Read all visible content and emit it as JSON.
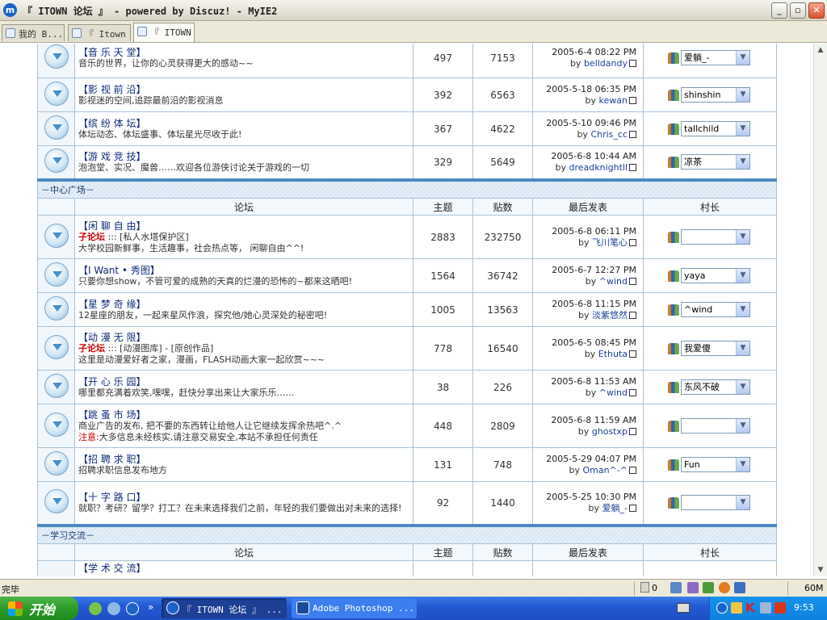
{
  "window": {
    "title": "『 ITOWN 论坛 』 - powered by Discuz! - MyIE2",
    "min": "_",
    "max": "▫",
    "close": "✕"
  },
  "tabs": [
    {
      "label": "我的 B..."
    },
    {
      "label": "『 Itown ..."
    },
    {
      "label": "『 ITOWN ..."
    }
  ],
  "forum": {
    "section1_rows": [
      {
        "name": "【音 乐 天 堂】",
        "desc": "音乐的世界，让你的心灵获得更大的感动~~",
        "topics": "497",
        "posts": "7153",
        "date": "2005-6-4 08:22 PM",
        "by": "by",
        "user": "belldandy",
        "moderator": "爱躺_-"
      },
      {
        "name": "【影 视 前 沿】",
        "desc": "影视迷的空间,追踪最前沿的影视消息",
        "topics": "392",
        "posts": "6563",
        "date": "2005-5-18 06:35 PM",
        "by": "by",
        "user": "kewan",
        "moderator": "shinshin"
      },
      {
        "name": "【缤 纷 体 坛】",
        "desc": "体坛动态、体坛盛事、体坛星光尽收于此!",
        "topics": "367",
        "posts": "4622",
        "date": "2005-5-10 09:46 PM",
        "by": "by",
        "user": "Chris_cc",
        "moderator": "tallchild"
      },
      {
        "name": "【游 戏 竞 技】",
        "desc": "泡泡堂、实况、魔兽……欢迎各位游侠讨论关于游戏的一切",
        "topics": "329",
        "posts": "5649",
        "date": "2005-6-8 10:44 AM",
        "by": "by",
        "user": "dreadknightll",
        "moderator": "凉茶"
      }
    ],
    "category_center": "－中心广场－",
    "header": {
      "forum": "论坛",
      "topics": "主题",
      "posts": "贴数",
      "last": "最后发表",
      "mod": "村长"
    },
    "section2_rows": [
      {
        "name": "【闲 聊 自 由】",
        "sub_red": "子论坛",
        "sub_text": " ::: [私人水塔保护区]",
        "desc": "大学校园新鲜事，生活趣事，社会热点等，  闲聊自由^^!",
        "topics": "2883",
        "posts": "232750",
        "date": "2005-6-8 06:11 PM",
        "by": "by",
        "user": "飞川笔心",
        "moderator": ""
      },
      {
        "name": "【I Want • 秀图】",
        "sub_red": "",
        "sub_text": "",
        "desc": "只要你想show，不管可爱的成熟的天真的烂漫的恐怖的~都来这晒吧!",
        "topics": "1564",
        "posts": "36742",
        "date": "2005-6-7 12:27 PM",
        "by": "by",
        "user": "^wind",
        "moderator": "yaya"
      },
      {
        "name": "【星 梦 奇 缘】",
        "sub_red": "",
        "sub_text": "",
        "desc": "12星座的朋友，一起来星风作浪，探究他/她心灵深处的秘密吧!",
        "topics": "1005",
        "posts": "13563",
        "date": "2005-6-8 11:15 PM",
        "by": "by",
        "user": "淡紫悠然",
        "moderator": "^wind"
      },
      {
        "name": "【动 漫 无 限】",
        "sub_red": "子论坛",
        "sub_text": " ::: [动漫图库] - [原创作品]",
        "desc": "这里是动漫爱好者之家，漫画，FLASH动画大家一起欣赏~~~",
        "topics": "778",
        "posts": "16540",
        "date": "2005-6-5 08:45 PM",
        "by": "by",
        "user": "Ethuta",
        "moderator": "我爱傻"
      },
      {
        "name": "【开 心 乐 园】",
        "sub_red": "",
        "sub_text": "",
        "desc": "哪里都充满着欢笑,嘿嘿，赶快分享出来让大家乐乐……",
        "topics": "38",
        "posts": "226",
        "date": "2005-6-8 11:53 AM",
        "by": "by",
        "user": "^wind",
        "moderator": "东风不破"
      },
      {
        "name": "【跳 蚤 市 场】",
        "sub_red": "",
        "sub_text": "",
        "desc": "商业广告的发布, 把不要的东西转让给他人让它继续发挥余热吧^.^",
        "note_red": "注意:",
        "note_text": "大多信息未经核实,请注意交易安全,本站不承担任何责任",
        "topics": "448",
        "posts": "2809",
        "date": "2005-6-8 11:59 AM",
        "by": "by",
        "user": "ghostxp",
        "moderator": ""
      },
      {
        "name": "【招 聘 求 职】",
        "sub_red": "",
        "sub_text": "",
        "desc": "招聘求职信息发布地方",
        "topics": "131",
        "posts": "748",
        "date": "2005-5-29 04:07 PM",
        "by": "by",
        "user": "Oman^-^",
        "moderator": "Fun"
      },
      {
        "name": "【十 字 路 口】",
        "sub_red": "",
        "sub_text": "",
        "desc": "就职？考研？留学？打工？在未来选择我们之前，年轻的我们要做出对未来的选择!",
        "topics": "92",
        "posts": "1440",
        "date": "2005-5-25 10:30 PM",
        "by": "by",
        "user": "爱躺_-",
        "moderator": ""
      }
    ],
    "category_study": "－学习交流－",
    "partial_row_name": "【学 术 交 流】"
  },
  "status": {
    "text": "完毕",
    "count": "0",
    "mem": "60M"
  },
  "taskbar": {
    "start": "开始",
    "more": "»",
    "task1": "『 ITOWN 论坛 』 ...",
    "task2": "Adobe Photoshop ...",
    "clock": "9:53",
    "tray_k": "K"
  },
  "colors": {
    "accent": "#4c89c1",
    "link": "#1b3f9a",
    "red": "#cc0000",
    "border": "#a9c3d8"
  }
}
